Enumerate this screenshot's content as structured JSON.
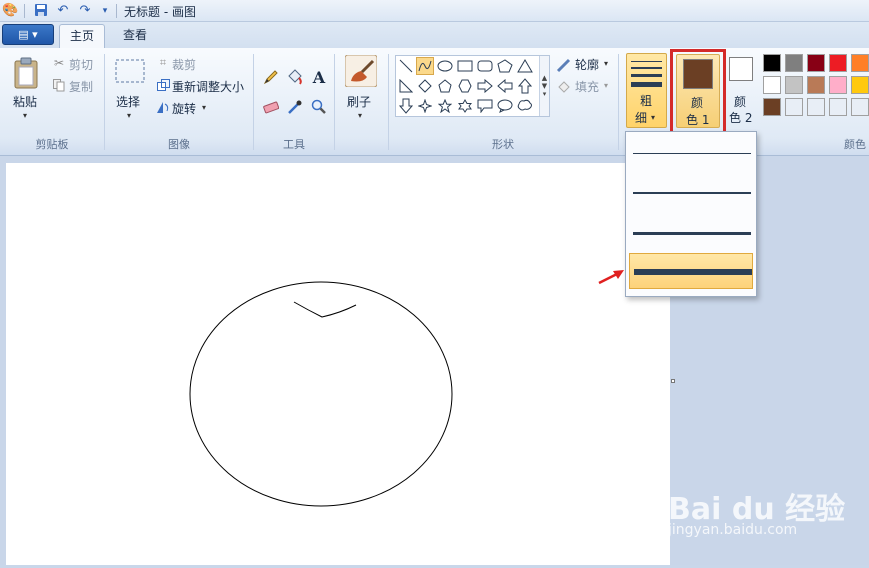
{
  "window": {
    "title": "无标题 - 画图"
  },
  "tabs": {
    "app_menu": "▤ ▾",
    "home": "主页",
    "view": "查看"
  },
  "clipboard": {
    "paste": "粘贴",
    "cut": "剪切",
    "copy": "复制",
    "group": "剪贴板"
  },
  "image": {
    "select": "选择",
    "crop": "裁剪",
    "resize": "重新调整大小",
    "rotate": "旋转",
    "group": "图像"
  },
  "tools": {
    "group": "工具"
  },
  "brushes": {
    "label": "刷子"
  },
  "shapes": {
    "outline": "轮廓",
    "fill": "填充",
    "group": "形状"
  },
  "size": {
    "label_line1": "粗",
    "label_line2": "细"
  },
  "colors": {
    "color1_line1": "颜",
    "color1_line2": "色 1",
    "color2_line1": "颜",
    "color2_line2": "色 2",
    "group": "颜色",
    "color1_value": "#6b3f24",
    "color2_value": "#ffffff",
    "palette_row1": [
      "#000000",
      "#7f7f7f",
      "#880015",
      "#ed1c24",
      "#ff7f27"
    ],
    "palette_row2": [
      "#ffffff",
      "#c3c3c3",
      "#b97a57",
      "#ffaec9",
      "#ffc90e"
    ],
    "palette_row3": [
      "#6b3f24",
      "#e8eef6",
      "#e8eef6",
      "#e8eef6",
      "#e8eef6"
    ]
  },
  "size_dropdown": {
    "options": [
      {
        "name": "size-1px",
        "thickness": 1
      },
      {
        "name": "size-3px",
        "thickness": 2
      },
      {
        "name": "size-5px",
        "thickness": 3
      },
      {
        "name": "size-8px",
        "thickness": 6
      }
    ],
    "selected_index": 3
  },
  "watermark": {
    "main": "Bai du 经验",
    "sub": "jingyan.baidu.com"
  }
}
